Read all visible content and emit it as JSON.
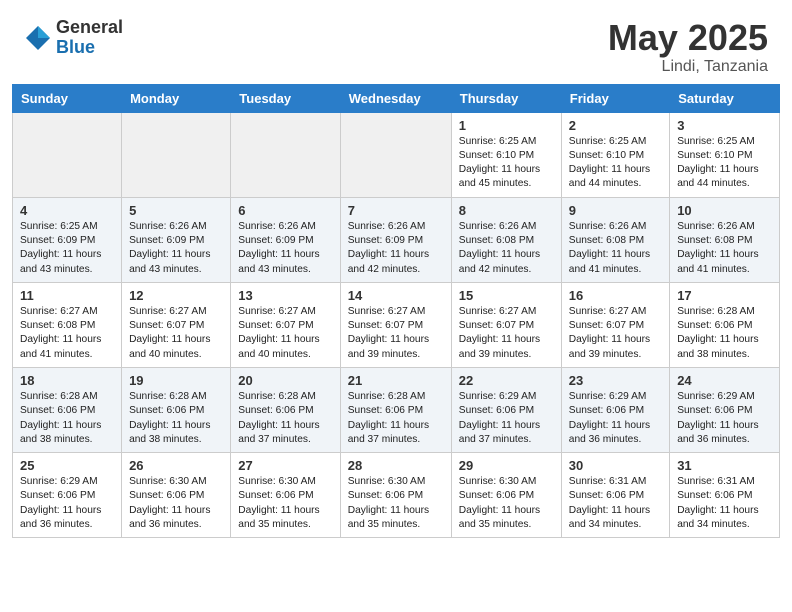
{
  "header": {
    "logo_general": "General",
    "logo_blue": "Blue",
    "title": "May 2025",
    "location": "Lindi, Tanzania"
  },
  "weekdays": [
    "Sunday",
    "Monday",
    "Tuesday",
    "Wednesday",
    "Thursday",
    "Friday",
    "Saturday"
  ],
  "weeks": [
    [
      {
        "day": "",
        "info": ""
      },
      {
        "day": "",
        "info": ""
      },
      {
        "day": "",
        "info": ""
      },
      {
        "day": "",
        "info": ""
      },
      {
        "day": "1",
        "info": "Sunrise: 6:25 AM\nSunset: 6:10 PM\nDaylight: 11 hours and 45 minutes."
      },
      {
        "day": "2",
        "info": "Sunrise: 6:25 AM\nSunset: 6:10 PM\nDaylight: 11 hours and 44 minutes."
      },
      {
        "day": "3",
        "info": "Sunrise: 6:25 AM\nSunset: 6:10 PM\nDaylight: 11 hours and 44 minutes."
      }
    ],
    [
      {
        "day": "4",
        "info": "Sunrise: 6:25 AM\nSunset: 6:09 PM\nDaylight: 11 hours and 43 minutes."
      },
      {
        "day": "5",
        "info": "Sunrise: 6:26 AM\nSunset: 6:09 PM\nDaylight: 11 hours and 43 minutes."
      },
      {
        "day": "6",
        "info": "Sunrise: 6:26 AM\nSunset: 6:09 PM\nDaylight: 11 hours and 43 minutes."
      },
      {
        "day": "7",
        "info": "Sunrise: 6:26 AM\nSunset: 6:09 PM\nDaylight: 11 hours and 42 minutes."
      },
      {
        "day": "8",
        "info": "Sunrise: 6:26 AM\nSunset: 6:08 PM\nDaylight: 11 hours and 42 minutes."
      },
      {
        "day": "9",
        "info": "Sunrise: 6:26 AM\nSunset: 6:08 PM\nDaylight: 11 hours and 41 minutes."
      },
      {
        "day": "10",
        "info": "Sunrise: 6:26 AM\nSunset: 6:08 PM\nDaylight: 11 hours and 41 minutes."
      }
    ],
    [
      {
        "day": "11",
        "info": "Sunrise: 6:27 AM\nSunset: 6:08 PM\nDaylight: 11 hours and 41 minutes."
      },
      {
        "day": "12",
        "info": "Sunrise: 6:27 AM\nSunset: 6:07 PM\nDaylight: 11 hours and 40 minutes."
      },
      {
        "day": "13",
        "info": "Sunrise: 6:27 AM\nSunset: 6:07 PM\nDaylight: 11 hours and 40 minutes."
      },
      {
        "day": "14",
        "info": "Sunrise: 6:27 AM\nSunset: 6:07 PM\nDaylight: 11 hours and 39 minutes."
      },
      {
        "day": "15",
        "info": "Sunrise: 6:27 AM\nSunset: 6:07 PM\nDaylight: 11 hours and 39 minutes."
      },
      {
        "day": "16",
        "info": "Sunrise: 6:27 AM\nSunset: 6:07 PM\nDaylight: 11 hours and 39 minutes."
      },
      {
        "day": "17",
        "info": "Sunrise: 6:28 AM\nSunset: 6:06 PM\nDaylight: 11 hours and 38 minutes."
      }
    ],
    [
      {
        "day": "18",
        "info": "Sunrise: 6:28 AM\nSunset: 6:06 PM\nDaylight: 11 hours and 38 minutes."
      },
      {
        "day": "19",
        "info": "Sunrise: 6:28 AM\nSunset: 6:06 PM\nDaylight: 11 hours and 38 minutes."
      },
      {
        "day": "20",
        "info": "Sunrise: 6:28 AM\nSunset: 6:06 PM\nDaylight: 11 hours and 37 minutes."
      },
      {
        "day": "21",
        "info": "Sunrise: 6:28 AM\nSunset: 6:06 PM\nDaylight: 11 hours and 37 minutes."
      },
      {
        "day": "22",
        "info": "Sunrise: 6:29 AM\nSunset: 6:06 PM\nDaylight: 11 hours and 37 minutes."
      },
      {
        "day": "23",
        "info": "Sunrise: 6:29 AM\nSunset: 6:06 PM\nDaylight: 11 hours and 36 minutes."
      },
      {
        "day": "24",
        "info": "Sunrise: 6:29 AM\nSunset: 6:06 PM\nDaylight: 11 hours and 36 minutes."
      }
    ],
    [
      {
        "day": "25",
        "info": "Sunrise: 6:29 AM\nSunset: 6:06 PM\nDaylight: 11 hours and 36 minutes."
      },
      {
        "day": "26",
        "info": "Sunrise: 6:30 AM\nSunset: 6:06 PM\nDaylight: 11 hours and 36 minutes."
      },
      {
        "day": "27",
        "info": "Sunrise: 6:30 AM\nSunset: 6:06 PM\nDaylight: 11 hours and 35 minutes."
      },
      {
        "day": "28",
        "info": "Sunrise: 6:30 AM\nSunset: 6:06 PM\nDaylight: 11 hours and 35 minutes."
      },
      {
        "day": "29",
        "info": "Sunrise: 6:30 AM\nSunset: 6:06 PM\nDaylight: 11 hours and 35 minutes."
      },
      {
        "day": "30",
        "info": "Sunrise: 6:31 AM\nSunset: 6:06 PM\nDaylight: 11 hours and 34 minutes."
      },
      {
        "day": "31",
        "info": "Sunrise: 6:31 AM\nSunset: 6:06 PM\nDaylight: 11 hours and 34 minutes."
      }
    ]
  ]
}
